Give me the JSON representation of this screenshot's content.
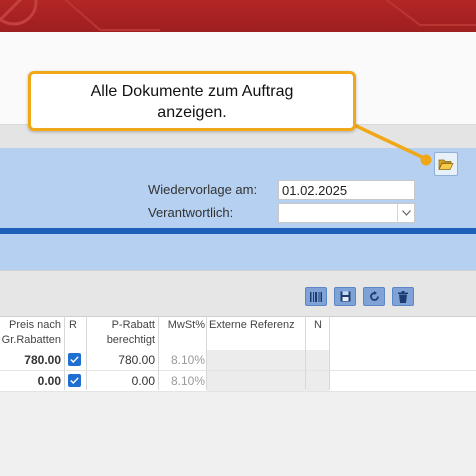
{
  "tooltip": {
    "line1": "Alle Dokumente zum Auftrag",
    "line2": "anzeigen."
  },
  "form": {
    "wiedervorlage_label": "Wiedervorlage am:",
    "wiedervorlage_value": "01.02.2025",
    "verantwortlich_label": "Verantwortlich:",
    "verantwortlich_value": ""
  },
  "toolbar": {
    "buttons": [
      "barcode-icon",
      "save-icon",
      "refresh-icon",
      "trash-icon"
    ]
  },
  "table": {
    "columns": [
      {
        "label_l1": "Preis nach",
        "label_l2": "Gr.Rabatten"
      },
      {
        "label_l1": "R",
        "label_l2": ""
      },
      {
        "label_l1": "P-Rabatt",
        "label_l2": "berechtigt"
      },
      {
        "label_l1": "MwSt%",
        "label_l2": ""
      },
      {
        "label_l1": "Externe Referenz",
        "label_l2": ""
      },
      {
        "label_l1": "N",
        "label_l2": ""
      }
    ],
    "rows": [
      {
        "preis": "780.00",
        "r_checked": true,
        "p_rabatt": "780.00",
        "mwst": "8.10%",
        "ext_ref": "",
        "n": ""
      },
      {
        "preis": "0.00",
        "r_checked": true,
        "p_rabatt": "0.00",
        "mwst": "8.10%",
        "ext_ref": "",
        "n": ""
      }
    ]
  },
  "colors": {
    "header_red": "#a82222",
    "form_blue": "#b5d0f0",
    "accent_blue": "#1e5fb8",
    "tooltip_border": "#f0a818"
  }
}
